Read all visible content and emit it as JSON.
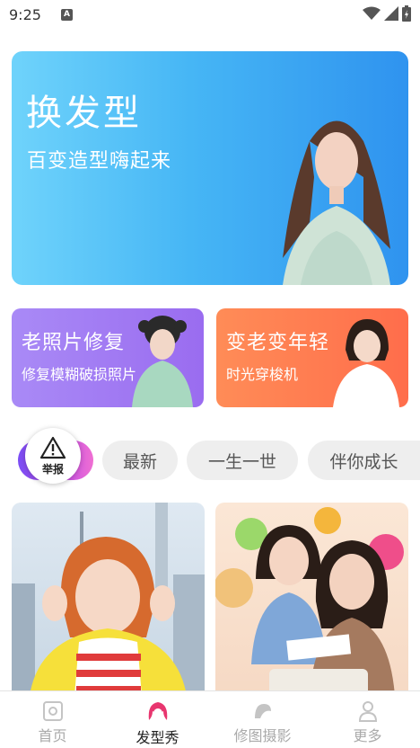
{
  "status_bar": {
    "time": "9:25",
    "notification_icon": "A",
    "icons": [
      "wifi-icon",
      "signal-icon",
      "battery-icon"
    ]
  },
  "hero": {
    "title": "换发型",
    "subtitle": "百变造型嗨起来"
  },
  "cards": [
    {
      "title": "老照片修复",
      "subtitle": "修复模糊破损照片",
      "color": "#9f78f3"
    },
    {
      "title": "变老变年轻",
      "subtitle": "时光穿梭机",
      "color": "#ff7750"
    }
  ],
  "filters": {
    "report_label": "举报",
    "chips": [
      "最新",
      "一生一世",
      "伴你成长"
    ]
  },
  "nav": {
    "items": [
      {
        "label": "首页",
        "icon": "photo-icon"
      },
      {
        "label": "发型秀",
        "icon": "hairstyle-icon"
      },
      {
        "label": "修图摄影",
        "icon": "retouch-icon"
      },
      {
        "label": "更多",
        "icon": "person-icon"
      }
    ],
    "active": "发型秀",
    "accent": "#e8366f"
  }
}
